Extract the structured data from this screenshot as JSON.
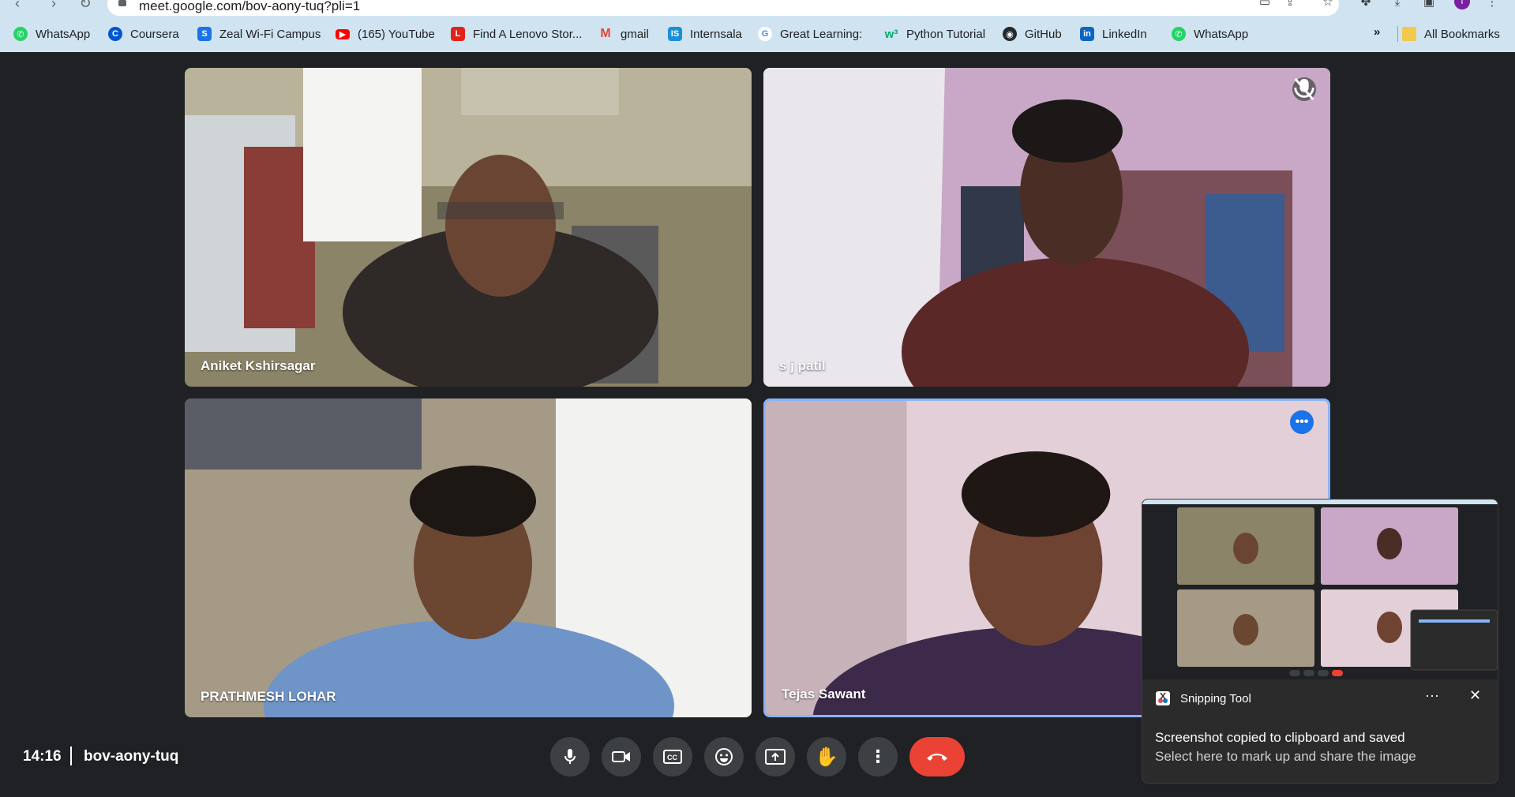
{
  "browser": {
    "url": "meet.google.com/bov-aony-tuq?pli=1",
    "bookmarks": [
      {
        "label": "WhatsApp",
        "icon": "whatsapp-icon",
        "color": "#25d366"
      },
      {
        "label": "Coursera",
        "icon": "coursera-icon",
        "color": "#0056d2"
      },
      {
        "label": "Zeal Wi-Fi Campus",
        "icon": "zeal-icon",
        "color": "#1a73e8"
      },
      {
        "label": "(165) YouTube",
        "icon": "youtube-icon",
        "color": "#ff0000"
      },
      {
        "label": "Find A Lenovo Stor...",
        "icon": "lenovo-icon",
        "color": "#e2231a"
      },
      {
        "label": "gmail",
        "icon": "gmail-icon",
        "color": "#ea4335"
      },
      {
        "label": "Internsala",
        "icon": "internshala-icon",
        "color": "#1a8fd8"
      },
      {
        "label": "Great Learning:",
        "icon": "google-icon",
        "color": "#4285f4"
      },
      {
        "label": "Python Tutorial",
        "icon": "w3schools-icon",
        "color": "#04aa6d"
      },
      {
        "label": "GitHub",
        "icon": "github-icon",
        "color": "#24292f"
      },
      {
        "label": "LinkedIn",
        "icon": "linkedin-icon",
        "color": "#0a66c2"
      },
      {
        "label": "WhatsApp",
        "icon": "whatsapp-icon",
        "color": "#25d366"
      }
    ],
    "more_bookmarks": "»",
    "all_bookmarks": "All Bookmarks"
  },
  "meet": {
    "participants": [
      {
        "name": "Aniket Kshirsagar",
        "muted": false,
        "active": false
      },
      {
        "name": "s j patil",
        "muted": true,
        "active": false
      },
      {
        "name": "PRATHMESH LOHAR",
        "muted": false,
        "active": false
      },
      {
        "name": "Tejas Sawant",
        "muted": false,
        "active": true
      }
    ],
    "time": "14:16",
    "meeting_code": "bov-aony-tuq",
    "controls": [
      "mic-icon",
      "camera-icon",
      "captions-icon",
      "emoji-icon",
      "present-icon",
      "raise-hand-icon",
      "more-options-icon",
      "end-call-icon"
    ],
    "accent": "#8ab4f8",
    "end_color": "#ea4335"
  },
  "toast": {
    "app": "Snipping Tool",
    "more": "···",
    "close": "✕",
    "message": "Screenshot copied to clipboard and saved",
    "submessage": "Select here to mark up and share the image"
  }
}
